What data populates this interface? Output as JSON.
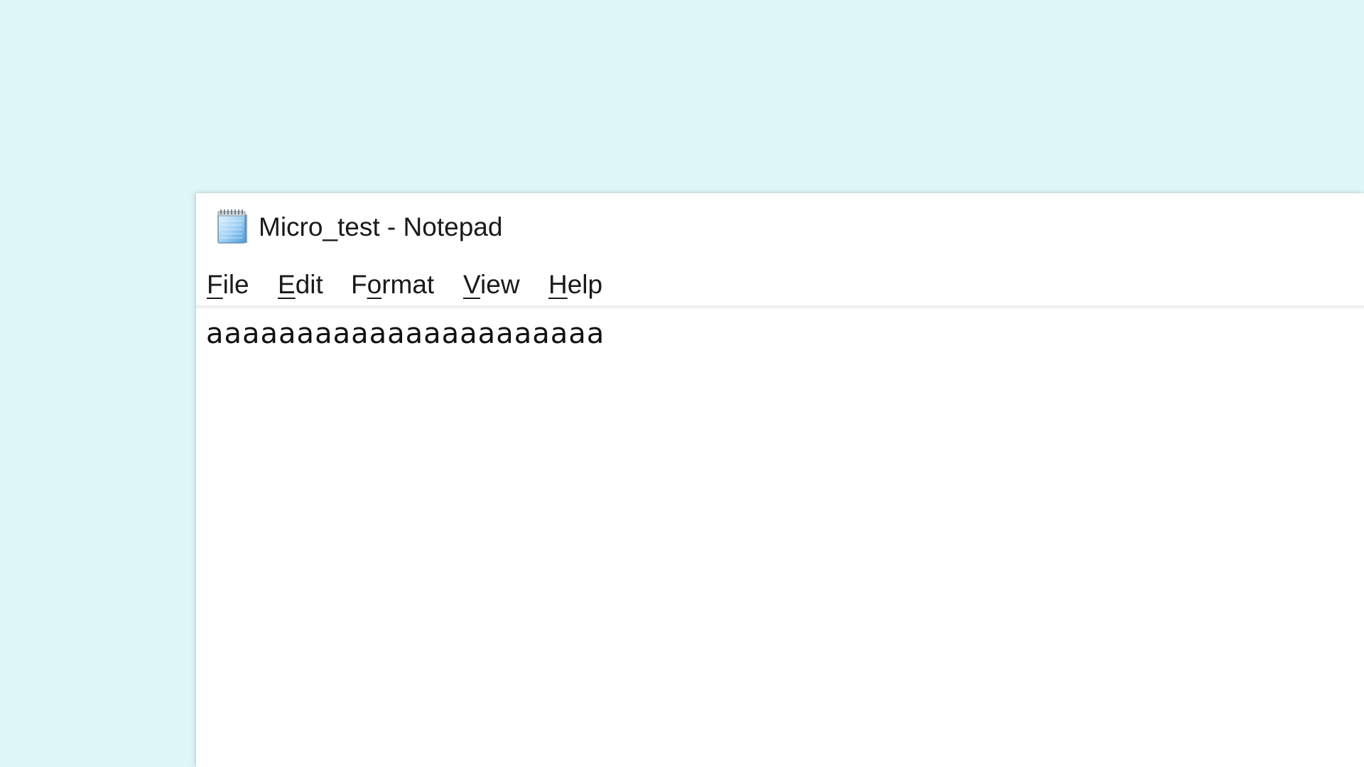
{
  "window": {
    "title": "Micro_test - Notepad",
    "icon": "notepad-icon"
  },
  "menubar": {
    "items": [
      {
        "mnemonic": "F",
        "rest": "ile"
      },
      {
        "mnemonic": "E",
        "rest": "dit"
      },
      {
        "pre": "F",
        "mnemonic": "o",
        "rest": "rmat"
      },
      {
        "mnemonic": "V",
        "rest": "iew"
      },
      {
        "mnemonic": "H",
        "rest": "elp"
      }
    ]
  },
  "editor": {
    "content": "aaaaaaaaaaaaaaaaaaaaaa"
  },
  "colors": {
    "desktop_background": "#dff7f8",
    "window_background": "#ffffff",
    "menubar_separator": "#f0f0f0",
    "text": "#1a1a1a"
  }
}
